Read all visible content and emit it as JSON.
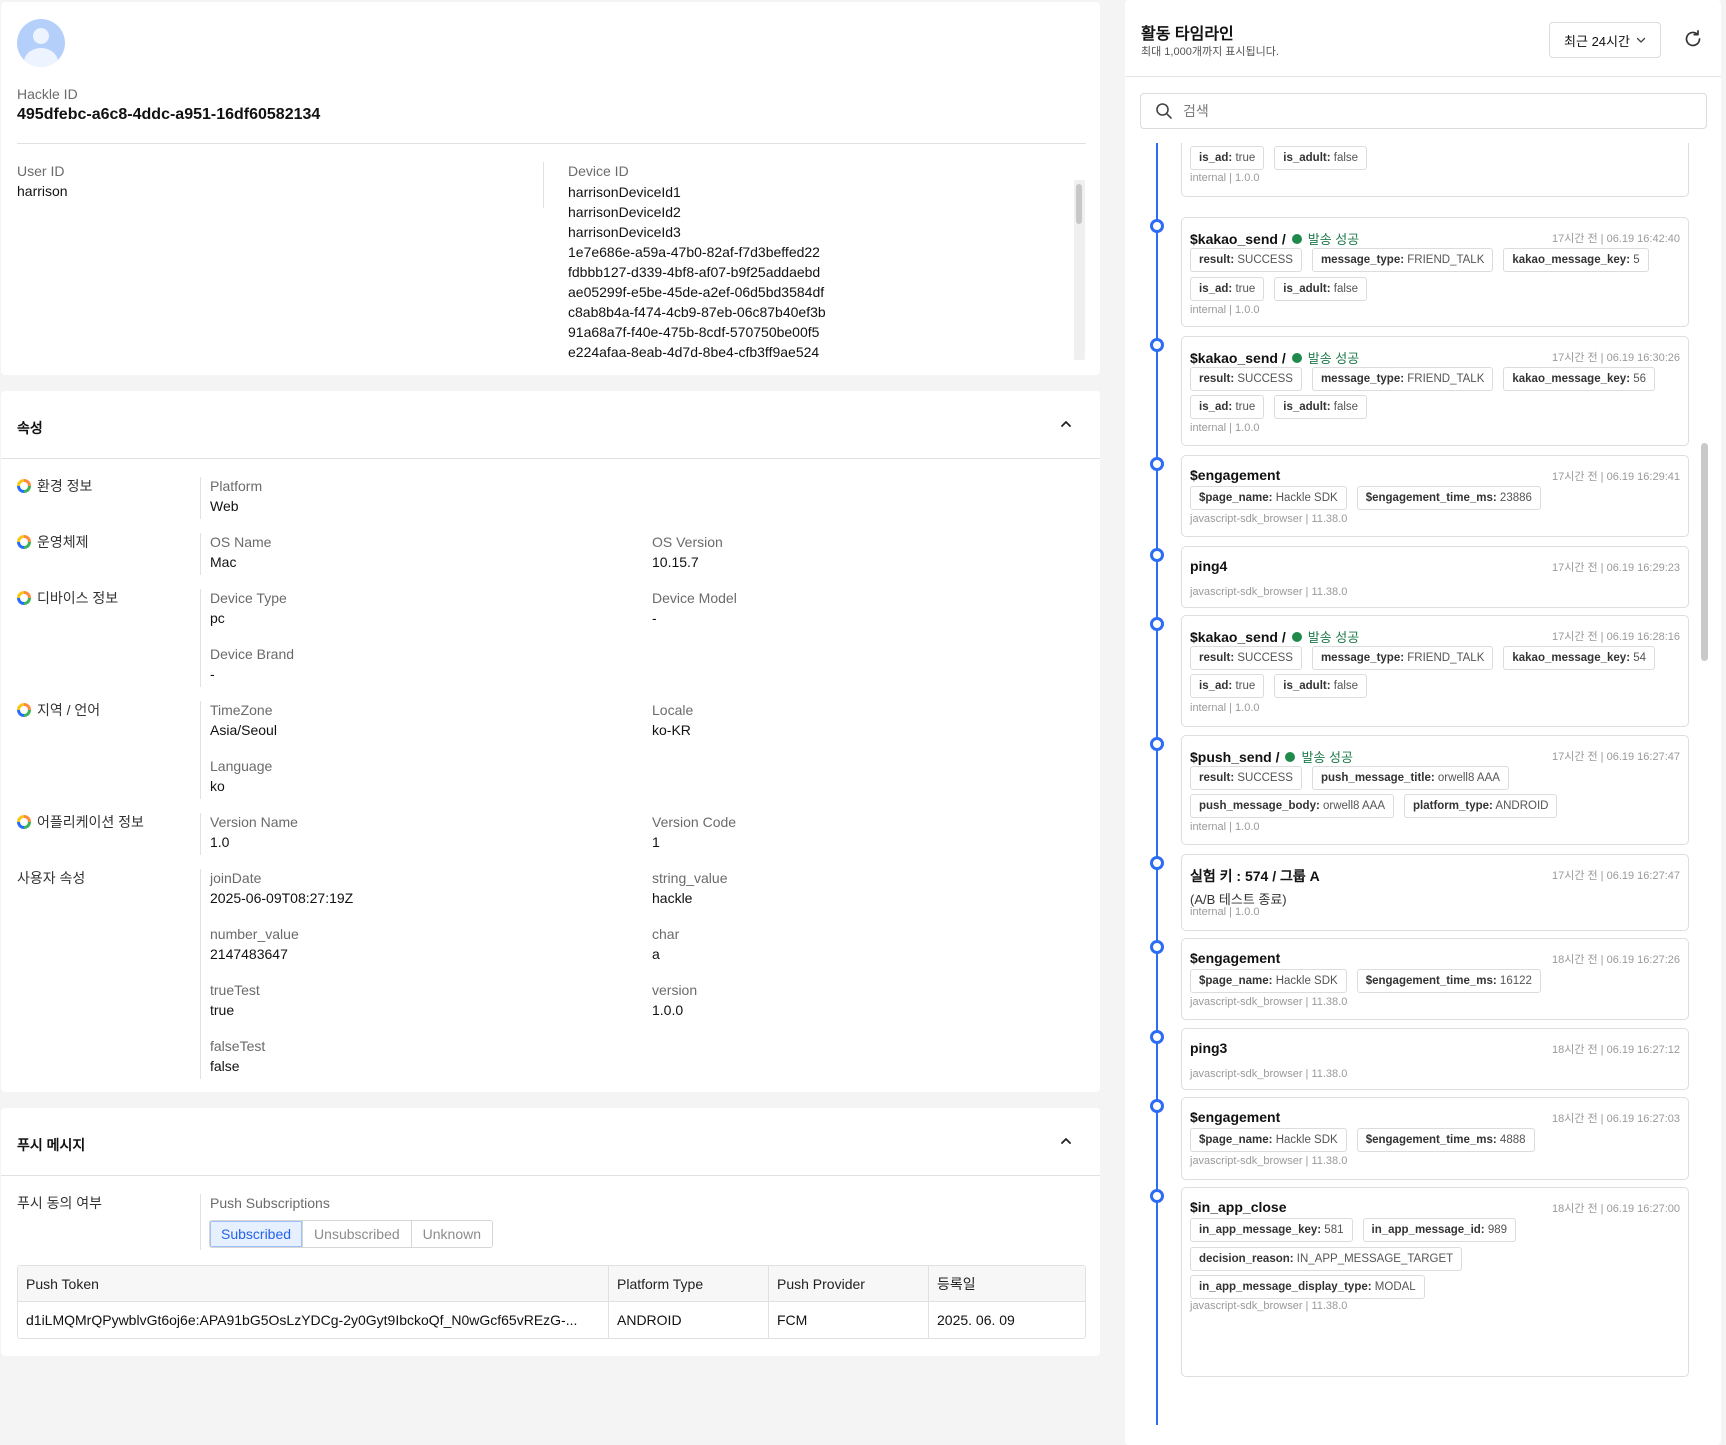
{
  "profile": {
    "hackle_id_label": "Hackle ID",
    "hackle_id": "495dfebc-a6c8-4ddc-a951-16df60582134",
    "user_id_label": "User ID",
    "user_id": "harrison",
    "device_id_label": "Device ID",
    "device_ids": [
      "harrisonDeviceId1",
      "harrisonDeviceId2",
      "harrisonDeviceId3",
      "1e7e686e-a59a-47b0-82af-f7d3beffed22",
      "fdbbb127-d339-4bf8-af07-b9f25addaebd",
      "ae05299f-e5be-45de-a2ef-06d5bd3584df",
      "c8ab8b4a-f474-4cb9-87eb-06c87b40ef3b",
      "91a68a7f-f40e-475b-8cdf-570750be00f5",
      "e224afaa-8eab-4d7d-8be4-cfb3ff9ae524"
    ]
  },
  "attributes": {
    "title": "속성",
    "groups": {
      "env": {
        "name": "환경 정보",
        "f1_label": "Platform",
        "f1_value": "Web"
      },
      "os": {
        "name": "운영체제",
        "f1_label": "OS Name",
        "f1_value": "Mac",
        "f2_label": "OS Version",
        "f2_value": "10.15.7"
      },
      "device": {
        "name": "디바이스 정보",
        "f1_label": "Device Type",
        "f1_value": "pc",
        "f2_label": "Device Model",
        "f2_value": "-",
        "f3_label": "Device Brand",
        "f3_value": "-"
      },
      "locale": {
        "name": "지역 / 언어",
        "f1_label": "TimeZone",
        "f1_value": "Asia/Seoul",
        "f2_label": "Locale",
        "f2_value": "ko-KR",
        "f3_label": "Language",
        "f3_value": "ko"
      },
      "app": {
        "name": "어플리케이션 정보",
        "f1_label": "Version Name",
        "f1_value": "1.0",
        "f2_label": "Version Code",
        "f2_value": "1"
      },
      "user": {
        "name": "사용자 속성",
        "f1_label": "joinDate",
        "f1_value": "2025-06-09T08:27:19Z",
        "f2_label": "string_value",
        "f2_value": "hackle",
        "f3_label": "number_value",
        "f3_value": "2147483647",
        "f4_label": "char",
        "f4_value": "a",
        "f5_label": "trueTest",
        "f5_value": "true",
        "f6_label": "version",
        "f6_value": "1.0.0",
        "f7_label": "falseTest",
        "f7_value": "false"
      }
    }
  },
  "push": {
    "title": "푸시 메시지",
    "consent_label": "푸시 동의 여부",
    "subscriptions_label": "Push Subscriptions",
    "options": [
      "Subscribed",
      "Unsubscribed",
      "Unknown"
    ],
    "selected": "Subscribed",
    "table": {
      "headers": [
        "Push Token",
        "Platform Type",
        "Push Provider",
        "등록일"
      ],
      "rows": [
        [
          "d1iLMQMrQPywblvGt6oj6e:APA91bG5OsLzYDCg-2y0Gyt9IbckoQf_N0wGcf65vREzG-...",
          "ANDROID",
          "FCM",
          "2025. 06. 09"
        ]
      ]
    }
  },
  "timeline": {
    "title": "활동 타임라인",
    "subtitle": "최대 1,000개까지 표시됩니다.",
    "range": "최근 24시간",
    "search_placeholder": "검색",
    "events": [
      {
        "name": "",
        "time": "",
        "status": "",
        "tags": [
          [
            [
              "is_ad:",
              "true"
            ],
            [
              "is_adult:",
              "false"
            ]
          ]
        ],
        "source": "internal | 1.0.0"
      },
      {
        "name": "$kakao_send /",
        "status": "발송 성공",
        "time": "17시간 전 | 06.19 16:42:40",
        "tags": [
          [
            [
              "result:",
              "SUCCESS"
            ],
            [
              "message_type:",
              "FRIEND_TALK"
            ],
            [
              "kakao_message_key:",
              "5"
            ]
          ],
          [
            [
              "is_ad:",
              "true"
            ],
            [
              "is_adult:",
              "false"
            ]
          ]
        ],
        "source": "internal | 1.0.0"
      },
      {
        "name": "$kakao_send /",
        "status": "발송 성공",
        "time": "17시간 전 | 06.19 16:30:26",
        "tags": [
          [
            [
              "result:",
              "SUCCESS"
            ],
            [
              "message_type:",
              "FRIEND_TALK"
            ],
            [
              "kakao_message_key:",
              "56"
            ]
          ],
          [
            [
              "is_ad:",
              "true"
            ],
            [
              "is_adult:",
              "false"
            ]
          ]
        ],
        "source": "internal | 1.0.0"
      },
      {
        "name": "$engagement",
        "status": "",
        "time": "17시간 전 | 06.19 16:29:41",
        "tags": [
          [
            [
              "$page_name:",
              "Hackle SDK"
            ],
            [
              "$engagement_time_ms:",
              "23886"
            ]
          ]
        ],
        "source": "javascript-sdk_browser | 11.38.0"
      },
      {
        "name": "ping4",
        "status": "",
        "time": "17시간 전 | 06.19 16:29:23",
        "tags": [],
        "source": "javascript-sdk_browser | 11.38.0"
      },
      {
        "name": "$kakao_send /",
        "status": "발송 성공",
        "time": "17시간 전 | 06.19 16:28:16",
        "tags": [
          [
            [
              "result:",
              "SUCCESS"
            ],
            [
              "message_type:",
              "FRIEND_TALK"
            ],
            [
              "kakao_message_key:",
              "54"
            ]
          ],
          [
            [
              "is_ad:",
              "true"
            ],
            [
              "is_adult:",
              "false"
            ]
          ]
        ],
        "source": "internal | 1.0.0"
      },
      {
        "name": "$push_send /",
        "status": "발송 성공",
        "time": "17시간 전 | 06.19 16:27:47",
        "tags": [
          [
            [
              "result:",
              "SUCCESS"
            ],
            [
              "push_message_title:",
              "orwell8 AAA"
            ]
          ],
          [
            [
              "push_message_body:",
              "orwell8 AAA"
            ],
            [
              "platform_type:",
              "ANDROID"
            ]
          ]
        ],
        "source": "internal | 1.0.0"
      },
      {
        "name": "실험 키 : 574 / 그룹 A",
        "status": "",
        "time": "17시간 전 | 06.19 16:27:47",
        "note": "(A/B 테스트 종료)",
        "tags": [],
        "source": "internal | 1.0.0"
      },
      {
        "name": "$engagement",
        "status": "",
        "time": "18시간 전 | 06.19 16:27:26",
        "tags": [
          [
            [
              "$page_name:",
              "Hackle SDK"
            ],
            [
              "$engagement_time_ms:",
              "16122"
            ]
          ]
        ],
        "source": "javascript-sdk_browser | 11.38.0"
      },
      {
        "name": "ping3",
        "status": "",
        "time": "18시간 전 | 06.19 16:27:12",
        "tags": [],
        "source": "javascript-sdk_browser | 11.38.0"
      },
      {
        "name": "$engagement",
        "status": "",
        "time": "18시간 전 | 06.19 16:27:03",
        "tags": [
          [
            [
              "$page_name:",
              "Hackle SDK"
            ],
            [
              "$engagement_time_ms:",
              "4888"
            ]
          ]
        ],
        "source": "javascript-sdk_browser | 11.38.0"
      },
      {
        "name": "$in_app_close",
        "status": "",
        "time": "18시간 전 | 06.19 16:27:00",
        "tags": [
          [
            [
              "in_app_message_key:",
              "581"
            ],
            [
              "in_app_message_id:",
              "989"
            ]
          ],
          [
            [
              "decision_reason:",
              "IN_APP_MESSAGE_TARGET"
            ]
          ],
          [
            [
              "in_app_message_display_type:",
              "MODAL"
            ]
          ]
        ],
        "source": "javascript-sdk_browser | 11.38.0"
      }
    ]
  },
  "colors": {
    "accent": "#2c6cf6",
    "success": "#1f8a4c",
    "selected_bg": "#e7f0ff"
  }
}
